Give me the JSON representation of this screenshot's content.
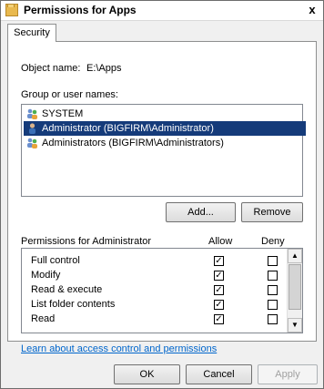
{
  "window": {
    "title": "Permissions for Apps",
    "close_label": "x"
  },
  "tabs": [
    {
      "label": "Security"
    }
  ],
  "object": {
    "label": "Object name:",
    "value": "E:\\Apps"
  },
  "groups": {
    "label": "Group or user names:",
    "items": [
      {
        "name": "SYSTEM",
        "icon": "users-group-icon"
      },
      {
        "name": "Administrator (BIGFIRM\\Administrator)",
        "icon": "user-icon",
        "selected": true
      },
      {
        "name": "Administrators (BIGFIRM\\Administrators)",
        "icon": "users-group-icon"
      }
    ]
  },
  "buttons": {
    "add": "Add...",
    "remove": "Remove",
    "ok": "OK",
    "cancel": "Cancel",
    "apply": "Apply"
  },
  "permissions": {
    "header": "Permissions for Administrator",
    "allow_header": "Allow",
    "deny_header": "Deny",
    "items": [
      {
        "name": "Full control",
        "allow": true,
        "deny": false
      },
      {
        "name": "Modify",
        "allow": true,
        "deny": false
      },
      {
        "name": "Read & execute",
        "allow": true,
        "deny": false
      },
      {
        "name": "List folder contents",
        "allow": true,
        "deny": false
      },
      {
        "name": "Read",
        "allow": true,
        "deny": false
      }
    ]
  },
  "link": "Learn about access control and permissions"
}
